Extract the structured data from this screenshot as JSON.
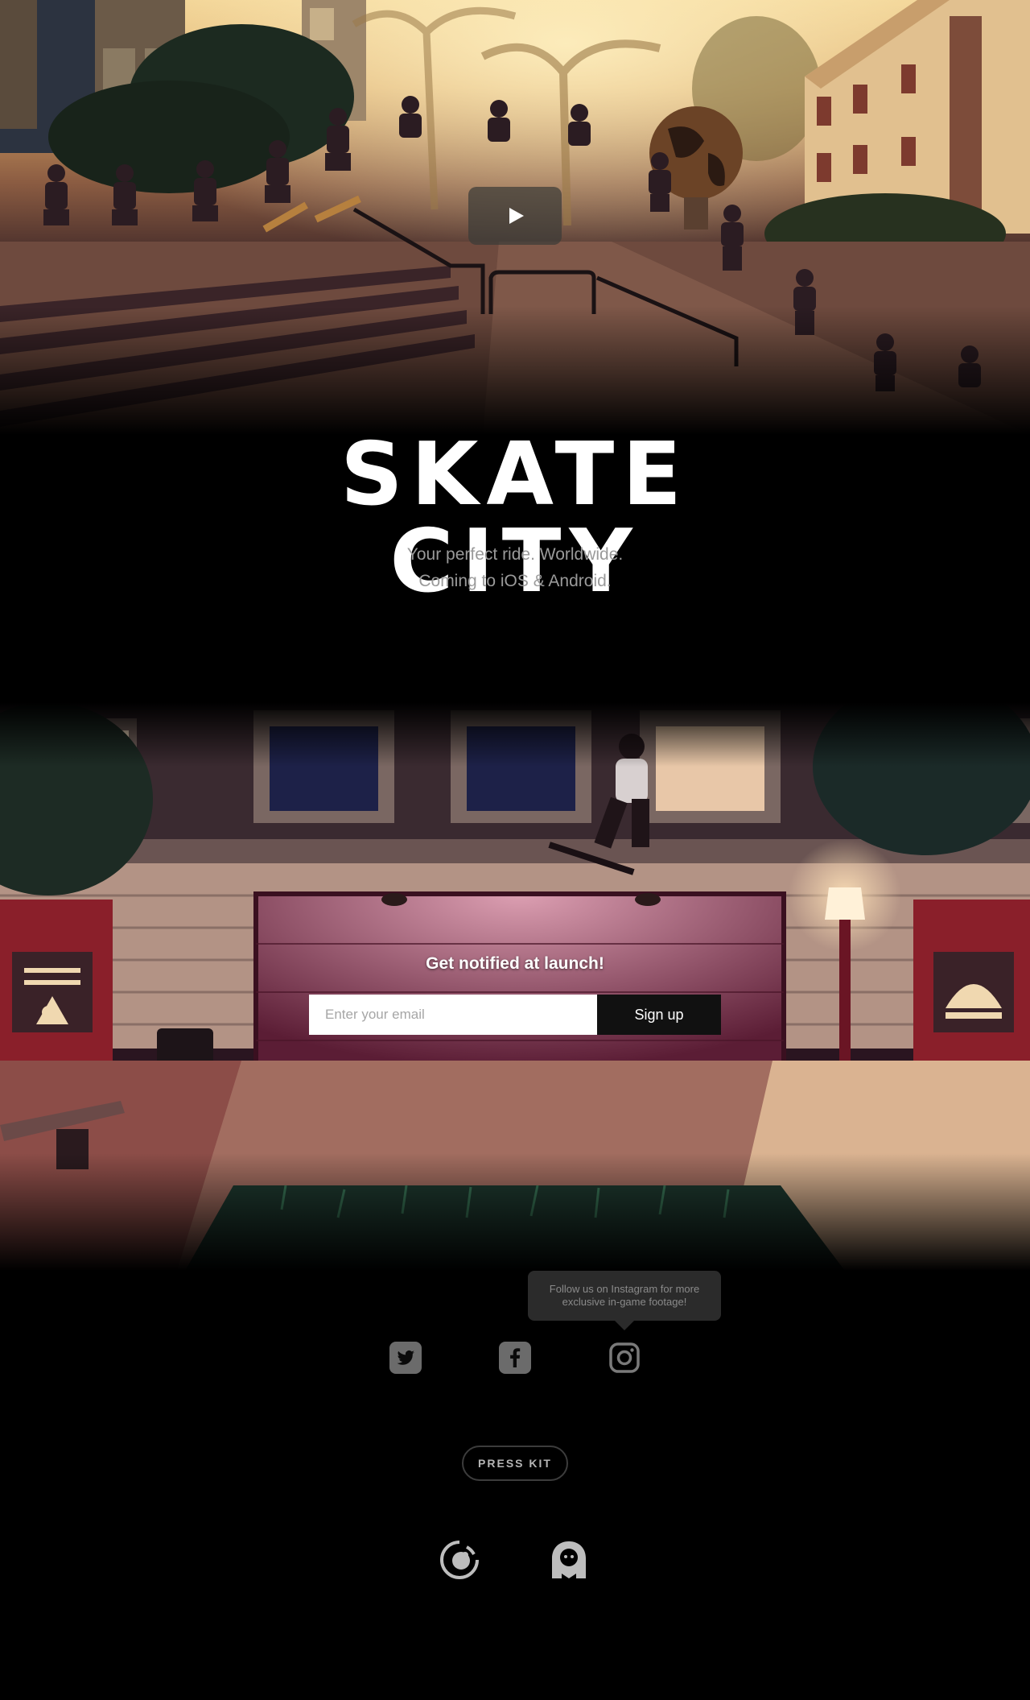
{
  "hero": {
    "title": "SKATE CITY",
    "tagline_line1": "Your perfect ride. Worldwide.",
    "tagline_line2": "Coming to iOS & Android.",
    "play_icon": "play-icon"
  },
  "signup": {
    "heading": "Get notified at launch!",
    "email_placeholder": "Enter your email",
    "button_label": "Sign up"
  },
  "social": {
    "tooltip": "Follow us on Instagram for more exclusive in-game footage!",
    "links": [
      {
        "icon": "twitter-icon"
      },
      {
        "icon": "facebook-icon"
      },
      {
        "icon": "instagram-icon"
      }
    ]
  },
  "press_kit": {
    "label": "PRESS KIT"
  },
  "studios": [
    {
      "icon": "studio-logo-icon"
    },
    {
      "icon": "studio-mascot-icon"
    }
  ],
  "colors": {
    "background": "#000000",
    "button_dark": "#111111",
    "tagline": "#9a9a9a",
    "tooltip_bg": "#2b2b2b"
  }
}
